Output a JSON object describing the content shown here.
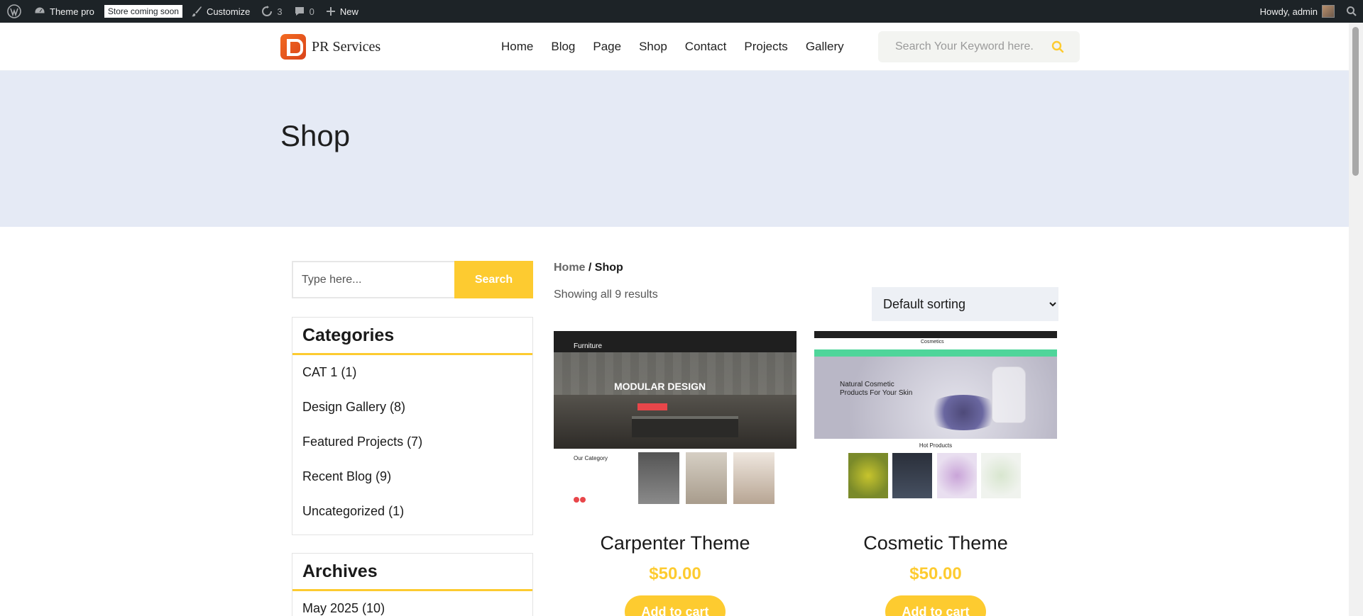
{
  "adminbar": {
    "site_name": "Theme pro",
    "store_badge": "Store coming soon",
    "customize": "Customize",
    "updates_count": "3",
    "comments_count": "0",
    "new_label": "New",
    "howdy": "Howdy, admin"
  },
  "header": {
    "logo_text": "PR Services",
    "nav": [
      "Home",
      "Blog",
      "Page",
      "Shop",
      "Contact",
      "Projects",
      "Gallery"
    ],
    "search_placeholder": "Search Your Keyword here."
  },
  "banner": {
    "title": "Shop"
  },
  "sidebar": {
    "search_placeholder": "Type here...",
    "search_button": "Search",
    "categories_title": "Categories",
    "categories": [
      "CAT 1 (1)",
      "Design Gallery (8)",
      "Featured Projects (7)",
      "Recent Blog (9)",
      "Uncategorized (1)"
    ],
    "archives_title": "Archives",
    "archives": [
      "May 2025 (10)"
    ]
  },
  "main": {
    "breadcrumb_home": "Home",
    "breadcrumb_sep": " / ",
    "breadcrumb_current": "Shop",
    "result_count": "Showing all 9 results",
    "sorting": "Default sorting",
    "products": [
      {
        "title": "Carpenter Theme",
        "price": "$50.00",
        "button": "Add to cart",
        "image": {
          "brand": "Furniture",
          "headline": "MODULAR DESIGN",
          "section": "Our Category"
        }
      },
      {
        "title": "Cosmetic Theme",
        "price": "$50.00",
        "button": "Add to cart",
        "image": {
          "brand": "Cosmetics",
          "headline": "Natural Cosmetic Products For Your Skin",
          "section": "Hot Products"
        }
      }
    ]
  },
  "colors": {
    "accent": "#fdcb30",
    "admin_bar": "#1d2327",
    "banner": "#e5eaf5"
  }
}
